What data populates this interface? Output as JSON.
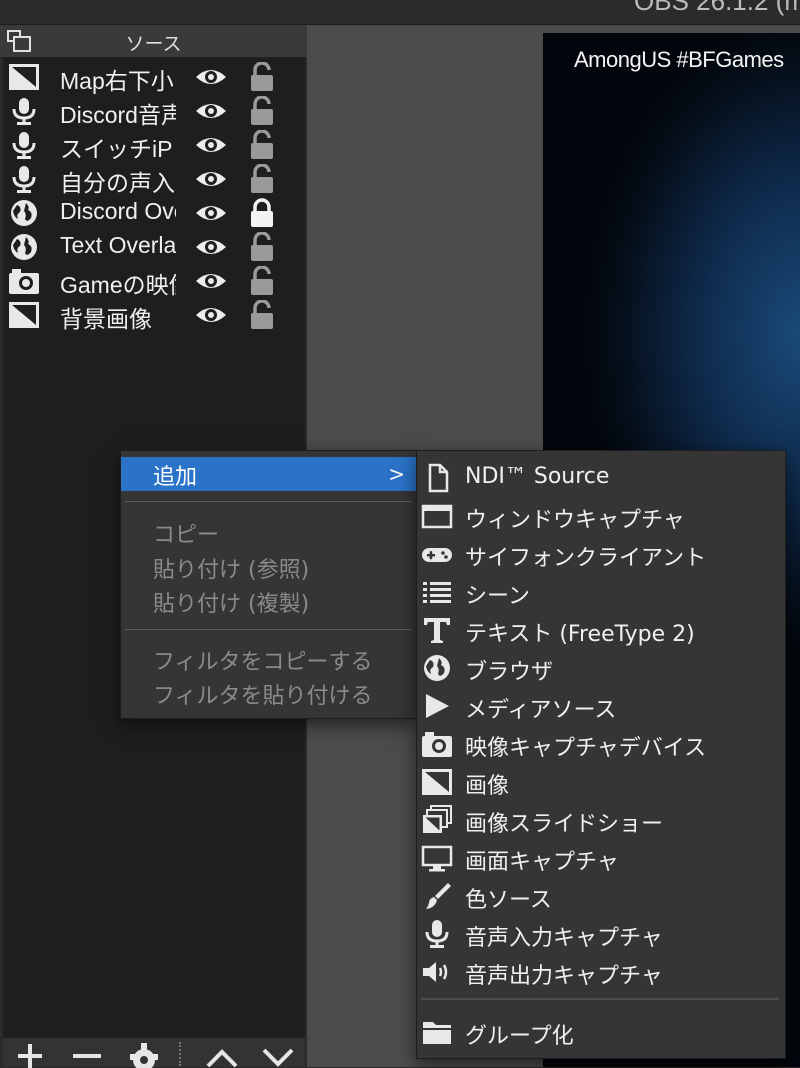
{
  "window": {
    "title": "OBS 26.1.2 (m"
  },
  "dock": {
    "title": "ソース",
    "sources": [
      {
        "name": "Map右下小",
        "type_icon": "image-icon",
        "locked": false
      },
      {
        "name": "Discord音声",
        "type_icon": "microphone-icon",
        "locked": false
      },
      {
        "name": "スイッチiP",
        "type_icon": "microphone-icon",
        "locked": false
      },
      {
        "name": "自分の声入",
        "type_icon": "microphone-icon",
        "locked": false
      },
      {
        "name": "Discord Overlay",
        "type_icon": "globe-icon",
        "locked": true
      },
      {
        "name": "Text Overlay",
        "type_icon": "globe-icon",
        "locked": false
      },
      {
        "name": "Gameの映像",
        "type_icon": "camera-icon",
        "locked": false
      },
      {
        "name": "背景画像",
        "type_icon": "image-icon",
        "locked": false
      }
    ],
    "toolbar": {
      "add_label": "+",
      "remove_label": "−",
      "settings_icon": "gear-icon",
      "up_label": "∧",
      "down_label": "∨"
    }
  },
  "preview": {
    "overlay_text": "AmongUS #BFGames"
  },
  "context_menu": {
    "add_label": "追加",
    "add_chevron": ">",
    "copy_label": "コピー",
    "paste_ref_label": "貼り付け (参照)",
    "paste_dup_label": "貼り付け (複製)",
    "copy_filters_label": "フィルタをコピーする",
    "paste_filters_label": "フィルタを貼り付ける"
  },
  "add_submenu": {
    "items": [
      {
        "label": "NDI™ Source",
        "icon": "document-icon"
      },
      {
        "label": "ウィンドウキャプチャ",
        "icon": "window-icon"
      },
      {
        "label": "サイフォンクライアント",
        "icon": "gamepad-icon"
      },
      {
        "label": "シーン",
        "icon": "list-icon"
      },
      {
        "label": "テキスト (FreeType 2)",
        "icon": "text-icon"
      },
      {
        "label": "ブラウザ",
        "icon": "globe-icon"
      },
      {
        "label": "メディアソース",
        "icon": "play-icon"
      },
      {
        "label": "映像キャプチャデバイス",
        "icon": "camera-icon"
      },
      {
        "label": "画像",
        "icon": "image-icon"
      },
      {
        "label": "画像スライドショー",
        "icon": "slideshow-icon"
      },
      {
        "label": "画面キャプチャ",
        "icon": "monitor-icon"
      },
      {
        "label": "色ソース",
        "icon": "brush-icon"
      },
      {
        "label": "音声入力キャプチャ",
        "icon": "microphone-icon"
      },
      {
        "label": "音声出力キャプチャ",
        "icon": "speaker-icon"
      }
    ],
    "group_label": "グループ化",
    "group_icon": "folder-icon"
  },
  "colors": {
    "menu_highlight": "#2a73c8",
    "menu_bg": "#353535",
    "dock_bg": "#1e1e1e",
    "preview_bg": "#4c4c4c"
  }
}
